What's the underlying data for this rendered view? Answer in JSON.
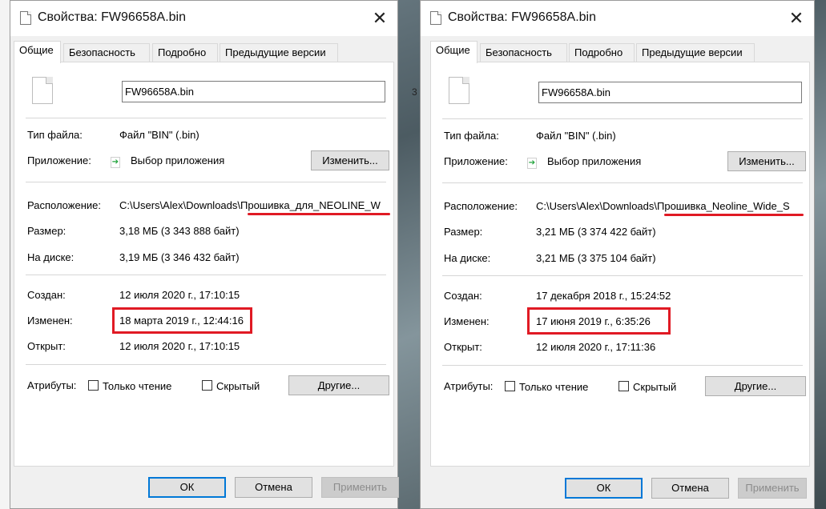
{
  "dialogs": [
    {
      "title": "Свойства: FW96658A.bin",
      "close_glyph": "✕",
      "tabs": [
        "Общие",
        "Безопасность",
        "Подробно",
        "Предыдущие версии"
      ],
      "file_name": "FW96658A.bin",
      "file_type_label": "Тип файла:",
      "file_type_value": "Файл \"BIN\" (.bin)",
      "app_label": "Приложение:",
      "app_value": "Выбор приложения",
      "change_button": "Изменить...",
      "location_label": "Расположение:",
      "location_value": "C:\\Users\\Alex\\Downloads\\Прошивка_для_NEOLINE_W",
      "size_label": "Размер:",
      "size_value": "3,18 МБ (3 343 888 байт)",
      "disk_label": "На диске:",
      "disk_value": "3,19 МБ (3 346 432 байт)",
      "created_label": "Создан:",
      "created_value": "12 июля 2020 г., 17:10:15",
      "modified_label": "Изменен:",
      "modified_value": "18 марта 2019 г., 12:44:16",
      "opened_label": "Открыт:",
      "opened_value": "12 июля 2020 г., 17:10:15",
      "attributes_label": "Атрибуты:",
      "readonly_label": "Только чтение",
      "hidden_label": "Скрытый",
      "other_button": "Другие...",
      "ok_button": "ОК",
      "cancel_button": "Отмена",
      "apply_button": "Применить"
    },
    {
      "title": "Свойства: FW96658A.bin",
      "close_glyph": "✕",
      "tabs": [
        "Общие",
        "Безопасность",
        "Подробно",
        "Предыдущие версии"
      ],
      "file_name": "FW96658A.bin",
      "file_type_label": "Тип файла:",
      "file_type_value": "Файл \"BIN\" (.bin)",
      "app_label": "Приложение:",
      "app_value": "Выбор приложения",
      "change_button": "Изменить...",
      "location_label": "Расположение:",
      "location_value": "C:\\Users\\Alex\\Downloads\\Прошивка_Neoline_Wide_S",
      "size_label": "Размер:",
      "size_value": "3,21 МБ (3 374 422 байт)",
      "disk_label": "На диске:",
      "disk_value": "3,21 МБ (3 375 104 байт)",
      "created_label": "Создан:",
      "created_value": "17 декабря 2018 г., 15:24:52",
      "modified_label": "Изменен:",
      "modified_value": "17 июня 2019 г., 6:35:26",
      "opened_label": "Открыт:",
      "opened_value": "12 июля 2020 г., 17:11:36",
      "attributes_label": "Атрибуты:",
      "readonly_label": "Только чтение",
      "hidden_label": "Скрытый",
      "other_button": "Другие...",
      "ok_button": "ОК",
      "cancel_button": "Отмена",
      "apply_button": "Применить"
    }
  ],
  "background_fragment": "3",
  "annotation_color": "#e01a24",
  "accent_color": "#0078d7",
  "icons": {
    "title": "file-icon",
    "close": "close-icon",
    "file": "blank-document-icon",
    "app": "app-picker-icon"
  }
}
